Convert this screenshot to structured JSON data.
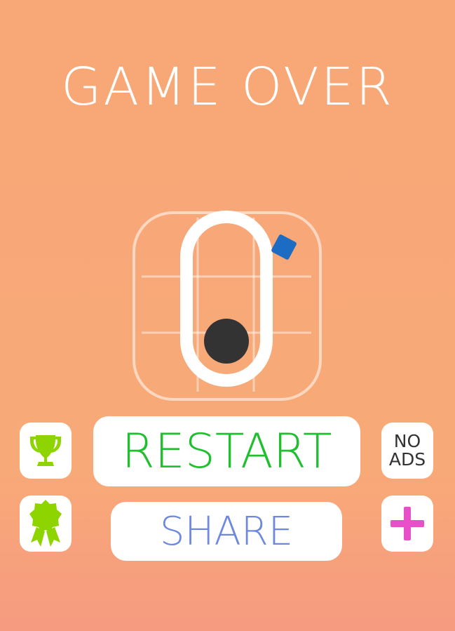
{
  "title": "GAME OVER",
  "buttons": {
    "restart": "RESTART",
    "share": "SHARE",
    "no_ads_line1": "NO",
    "no_ads_line2": "ADS"
  },
  "icons": {
    "leaderboard": "trophy-icon",
    "achievements": "ribbon-icon",
    "more": "plus-icon"
  },
  "colors": {
    "background": "#f8a877",
    "restart_text": "#1fbf2f",
    "share_text": "#6e88e0",
    "trophy": "#8ed400",
    "plus": "#e94fc8",
    "block": "#1c6cc4",
    "ball": "#333333"
  }
}
